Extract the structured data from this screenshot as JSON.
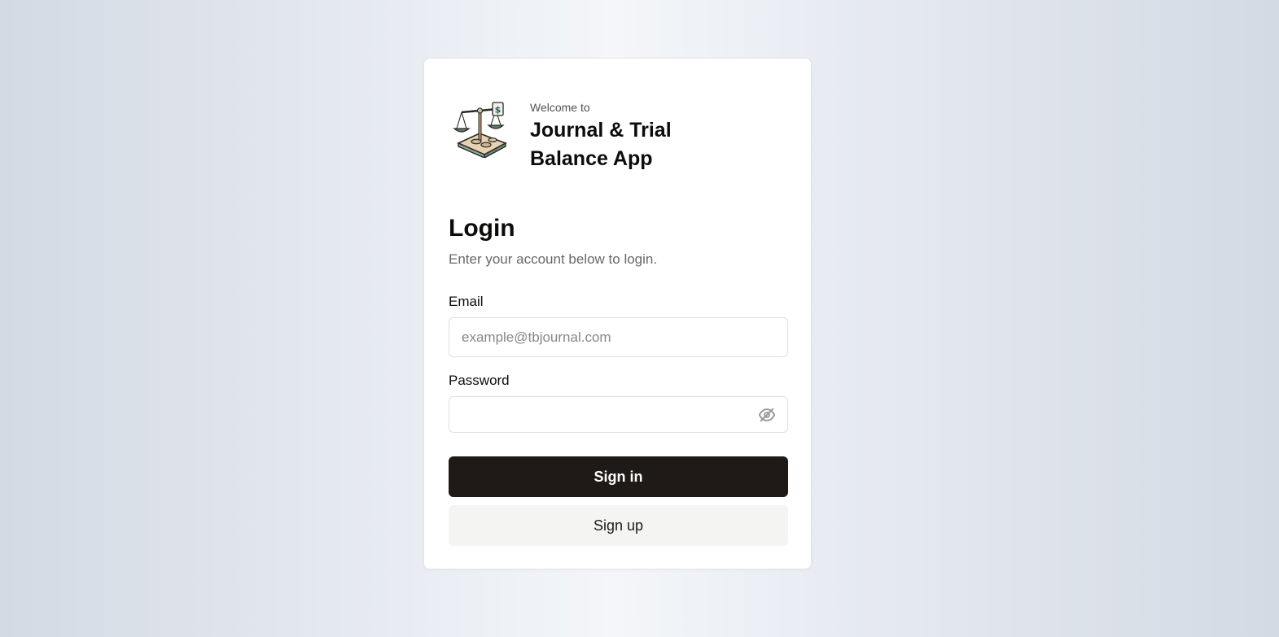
{
  "brand": {
    "welcome": "Welcome to",
    "app_name": "Journal & Trial Balance App",
    "logo_icon": "scales-ledger-icon"
  },
  "login": {
    "title": "Login",
    "subtitle": "Enter your account below to login."
  },
  "email": {
    "label": "Email",
    "placeholder": "example@tbjournal.com",
    "value": ""
  },
  "password": {
    "label": "Password",
    "value": "",
    "toggle_icon": "eye-off-icon"
  },
  "buttons": {
    "signin": "Sign in",
    "signup": "Sign up"
  },
  "colors": {
    "primary_button": "#1f1a17",
    "secondary_button": "#f4f4f3"
  }
}
